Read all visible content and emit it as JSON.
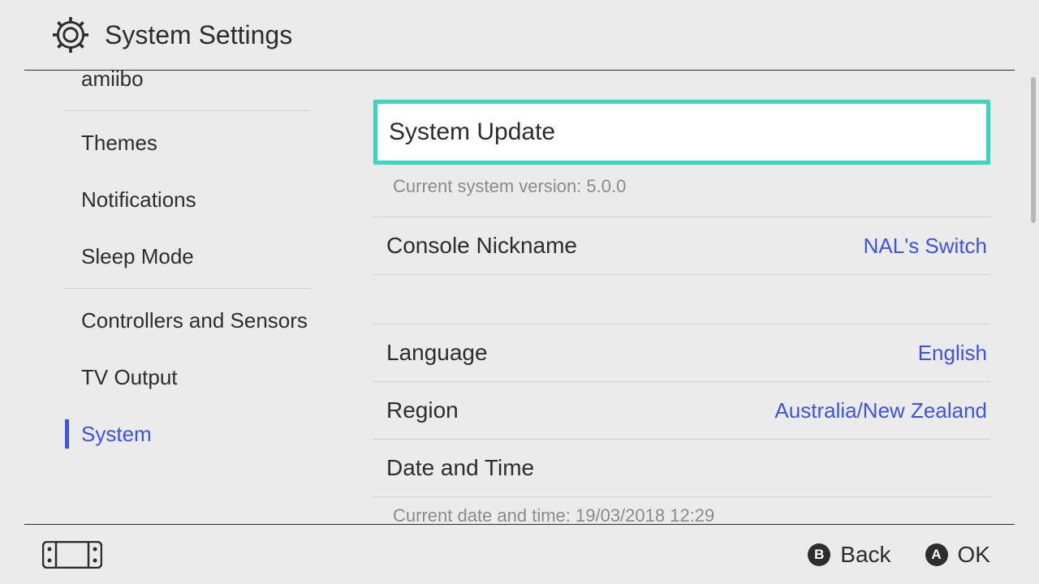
{
  "header": {
    "title": "System Settings"
  },
  "sidebar": {
    "items": [
      {
        "label": "amiibo",
        "selected": false,
        "divider_after": true
      },
      {
        "label": "Themes",
        "selected": false
      },
      {
        "label": "Notifications",
        "selected": false
      },
      {
        "label": "Sleep Mode",
        "selected": false,
        "divider_after": true
      },
      {
        "label": "Controllers and Sensors",
        "selected": false
      },
      {
        "label": "TV Output",
        "selected": false
      },
      {
        "label": "System",
        "selected": true
      }
    ]
  },
  "main": {
    "system_update": {
      "label": "System Update",
      "subtext": "Current system version: 5.0.0"
    },
    "console_nickname": {
      "label": "Console Nickname",
      "value": "NAL's Switch"
    },
    "language": {
      "label": "Language",
      "value": "English"
    },
    "region": {
      "label": "Region",
      "value": "Australia/New Zealand"
    },
    "date_time": {
      "label": "Date and Time",
      "subtext": "Current date and time: 19/03/2018 12:29"
    }
  },
  "footer": {
    "back": {
      "glyph": "B",
      "label": "Back"
    },
    "ok": {
      "glyph": "A",
      "label": "OK"
    }
  }
}
